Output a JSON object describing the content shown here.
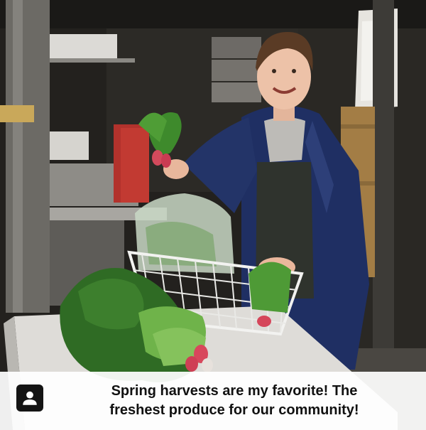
{
  "caption": {
    "line1": "Spring harvests are my favorite! The",
    "line2": "freshest produce for our community!"
  },
  "profile_icon": "person-icon"
}
